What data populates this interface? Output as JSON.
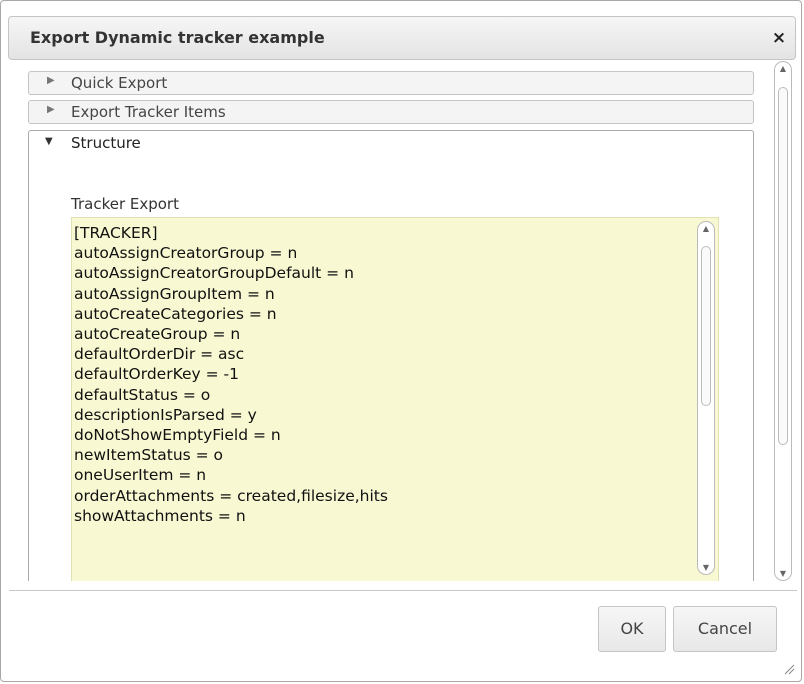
{
  "dialog": {
    "title": "Export Dynamic tracker example",
    "close_symbol": "×"
  },
  "accordion": {
    "sections": [
      {
        "label": "Quick Export",
        "expanded": false
      },
      {
        "label": "Export Tracker Items",
        "expanded": false
      },
      {
        "label": "Structure",
        "expanded": true
      }
    ],
    "collapsed_icon": "▶",
    "expanded_icon": "▼"
  },
  "structure": {
    "field_label": "Tracker Export",
    "lines": [
      "[TRACKER]",
      "autoAssignCreatorGroup = n",
      "autoAssignCreatorGroupDefault = n",
      "autoAssignGroupItem = n",
      "autoCreateCategories = n",
      "autoCreateGroup = n",
      "defaultOrderDir = asc",
      "defaultOrderKey = -1",
      "defaultStatus = o",
      "descriptionIsParsed = y",
      "doNotShowEmptyField = n",
      "newItemStatus = o",
      "oneUserItem = n",
      "orderAttachments = created,filesize,hits",
      "showAttachments = n"
    ]
  },
  "footer": {
    "ok_label": "OK",
    "cancel_label": "Cancel"
  },
  "colors": {
    "textarea_bg": "#f8f8d2",
    "header_bg": "#f4f4f4"
  }
}
